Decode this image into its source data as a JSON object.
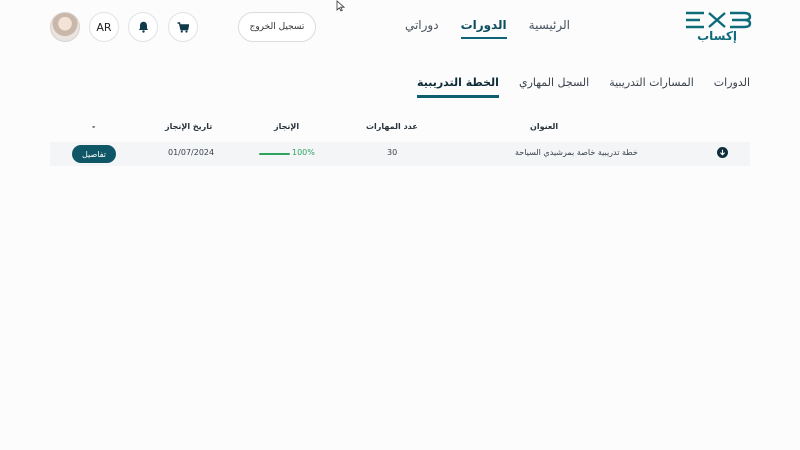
{
  "header": {
    "logo_text": "إكساب",
    "nav": [
      {
        "label": "الرئيسية",
        "active": false
      },
      {
        "label": "الدورات",
        "active": true
      },
      {
        "label": "دوراتي",
        "active": false
      }
    ],
    "logout_label": "تسجيل الخروج",
    "language_label": "AR"
  },
  "tabs": [
    {
      "label": "الدورات",
      "active": false
    },
    {
      "label": "المسارات التدريبية",
      "active": false
    },
    {
      "label": "السجل المهاري",
      "active": false
    },
    {
      "label": "الخطة التدريبية",
      "active": true
    }
  ],
  "table": {
    "headers": {
      "title": "العنوان",
      "skills_count": "عدد المهارات",
      "completion": "الإنجاز",
      "completion_date": "تاريخ الإنجاز",
      "actions": "-"
    },
    "rows": [
      {
        "title": "خطة تدريبية خاصة بمرشيدي السياحة",
        "skills_count": "30",
        "completion": "100%",
        "completion_fraction": 1.0,
        "completion_date": "01/07/2024",
        "details_label": "تفاصيل"
      }
    ]
  },
  "colors": {
    "brand": "#0f5666",
    "progress": "#2ea55e",
    "active_tab_underline": "#0f5e70"
  },
  "icons": [
    "cart-icon",
    "bell-icon",
    "arrow-down-circle-icon",
    "mouse-cursor-icon"
  ]
}
